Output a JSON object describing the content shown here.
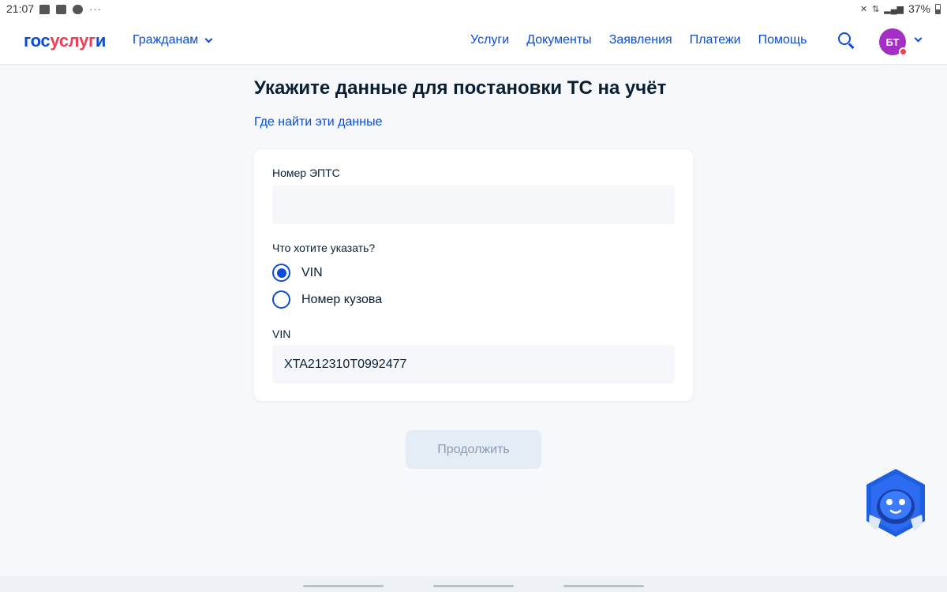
{
  "status_bar": {
    "time": "21:07",
    "battery": "37%",
    "left_icons": [
      "message-icon",
      "image-icon",
      "cloud-icon"
    ],
    "overflow": "···"
  },
  "header": {
    "logo_part1": "гос",
    "logo_part2": "услуг",
    "logo_part3": "и",
    "citizens_menu": "Гражданам",
    "nav": [
      "Услуги",
      "Документы",
      "Заявления",
      "Платежи",
      "Помощь"
    ],
    "avatar_initials": "БТ"
  },
  "main": {
    "title": "Укажите данные для постановки ТС на учёт",
    "help_link": "Где найти эти данные",
    "form": {
      "epts_label": "Номер ЭПТС",
      "epts_value": "",
      "choice_label": "Что хотите указать?",
      "options": [
        "VIN",
        "Номер кузова"
      ],
      "selected_option": "VIN",
      "vin_label": "VIN",
      "vin_value": "XTA212310T0992477"
    },
    "continue_button": "Продолжить"
  },
  "colors": {
    "brand_blue": "#0d4cd3",
    "brand_red": "#ee3f58",
    "avatar": "#a42fc5",
    "page_bg": "#f6f8fb"
  }
}
